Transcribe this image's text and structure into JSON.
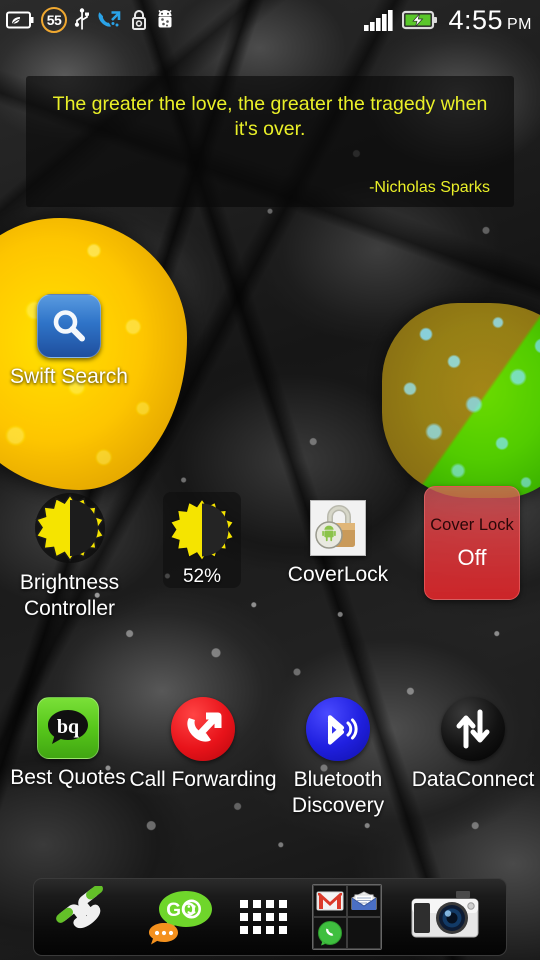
{
  "status_bar": {
    "left_icons": [
      {
        "name": "battery-saver-leaf-icon",
        "label": "battery saver"
      },
      {
        "name": "notification-count-badge",
        "label": "55"
      },
      {
        "name": "usb-icon",
        "label": "USB connected"
      },
      {
        "name": "call-forwarding-icon",
        "label": "call forwarding"
      },
      {
        "name": "screen-lock-icon",
        "label": "lock"
      },
      {
        "name": "android-system-icon",
        "label": "android"
      }
    ],
    "notification_count": "55",
    "right_icons": [
      {
        "name": "signal-bars-icon",
        "label": "signal",
        "bars": 5
      },
      {
        "name": "battery-charging-icon",
        "label": "charging"
      }
    ],
    "time": "4:55",
    "am_pm": "PM",
    "accent_badge_color": "#f0a830"
  },
  "quote_widget": {
    "text": "The greater the love, the greater the tragedy when it's over.",
    "author": "-Nicholas Sparks",
    "text_color": "#eaf028"
  },
  "icons": [
    {
      "name": "swift-search",
      "label": "Swift Search",
      "icon": "magnifier-icon"
    },
    {
      "name": "brightness-controller",
      "label": "Brightness Controller",
      "icon": "sun-icon"
    },
    {
      "name": "coverlock",
      "label": "CoverLock",
      "icon": "padlock-android-icon"
    },
    {
      "name": "best-quotes",
      "label": "Best Quotes",
      "icon": "speech-bubble-bq-icon"
    },
    {
      "name": "call-forwarding",
      "label": "Call Forwarding",
      "icon": "phone-arrow-icon"
    },
    {
      "name": "bluetooth-discovery",
      "label": "Bluetooth Discovery",
      "icon": "bluetooth-icon"
    },
    {
      "name": "data-connect",
      "label": "DataConnect",
      "icon": "up-down-arrows-icon"
    }
  ],
  "brightness_widget": {
    "percent": "52%",
    "icon": "sun-icon"
  },
  "coverlock_widget": {
    "title": "Cover Lock",
    "state": "Off",
    "color": "#d6262a"
  },
  "dock": [
    {
      "name": "phone",
      "label": "Phone",
      "icon": "handset-icon"
    },
    {
      "name": "go-sms",
      "label": "GO SMS",
      "icon": "chat-bubble-go-icon"
    },
    {
      "name": "app-drawer",
      "label": "Apps",
      "icon": "grid-dots-icon"
    },
    {
      "name": "mail-folder",
      "label": "Mail folder",
      "icon": "folder-icon",
      "contents": [
        {
          "name": "gmail",
          "icon": "gmail-icon"
        },
        {
          "name": "email",
          "icon": "email-envelope-icon"
        },
        {
          "name": "whatsapp",
          "icon": "whatsapp-icon"
        },
        {
          "name": "empty-slot",
          "icon": "empty-icon"
        }
      ]
    },
    {
      "name": "camera",
      "label": "Camera",
      "icon": "camera-icon"
    }
  ]
}
